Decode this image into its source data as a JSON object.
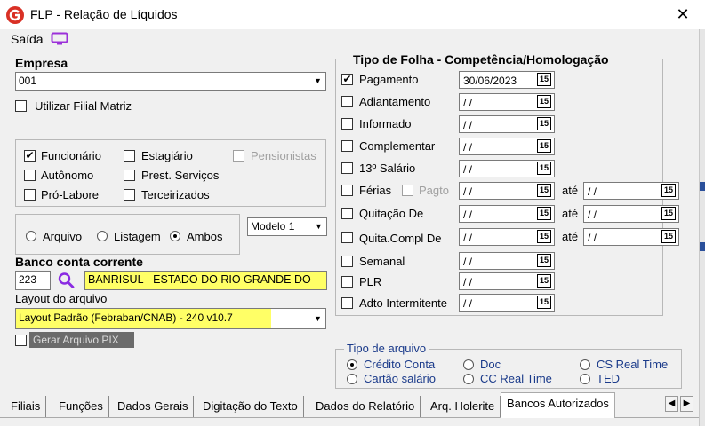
{
  "window": {
    "title": "FLP - Relação de Líquidos",
    "close_label": "✕"
  },
  "menu": {
    "saida_label": "Saída",
    "icon": "monitor-icon"
  },
  "empresa": {
    "label": "Empresa",
    "value": "001",
    "utilizar_filial_matriz": {
      "label": "Utilizar Filial Matriz",
      "checked": false
    }
  },
  "tipo_pessoa": [
    {
      "label": "Funcionário",
      "checked": true,
      "disabled": false
    },
    {
      "label": "Estagiário",
      "checked": false,
      "disabled": false
    },
    {
      "label": "Pensionistas",
      "checked": false,
      "disabled": true
    },
    {
      "label": "Autônomo",
      "checked": false,
      "disabled": false
    },
    {
      "label": "Prest. Serviços",
      "checked": false,
      "disabled": false
    },
    {
      "label": "Pró-Labore",
      "checked": false,
      "disabled": false
    },
    {
      "label": "Terceirizados",
      "checked": false,
      "disabled": false
    }
  ],
  "saida_tipo": {
    "options": [
      "Arquivo",
      "Listagem",
      "Ambos"
    ],
    "selected": "Ambos",
    "modelo": "Modelo 1"
  },
  "banco": {
    "label": "Banco conta corrente",
    "code": "223",
    "name": "BANRISUL - ESTADO DO RIO GRANDE DO"
  },
  "layout": {
    "label": "Layout do arquivo",
    "value": "Layout Padrão (Febraban/CNAB) - 240 v10.7"
  },
  "gerar_pix": {
    "label": "Gerar Arquivo PIX",
    "checked": false
  },
  "tipo_folha": {
    "header": "Tipo de Folha  -  Competência/Homologação",
    "ate_label": "até",
    "pagto_label": "Pagto",
    "cal_icon_text": "15",
    "rows": [
      {
        "label": "Pagamento",
        "checked": true,
        "date": "30/06/2023",
        "ate": null
      },
      {
        "label": "Adiantamento",
        "checked": false,
        "date": " /  /",
        "ate": null
      },
      {
        "label": "Informado",
        "checked": false,
        "date": " /  /",
        "ate": null
      },
      {
        "label": "Complementar",
        "checked": false,
        "date": " / /",
        "ate": null
      },
      {
        "label": "13º Salário",
        "checked": false,
        "date": " /  /",
        "ate": null
      },
      {
        "label": "Férias",
        "checked": false,
        "date": " /  /",
        "ate": " /  /"
      },
      {
        "label": "Quitação De",
        "checked": false,
        "date": " /  /",
        "ate": " /  /"
      },
      {
        "label": "Quita.Compl De",
        "checked": false,
        "date": " /  /",
        "ate": " /  /"
      },
      {
        "label": "Semanal",
        "checked": false,
        "date": " /  /",
        "ate": null
      },
      {
        "label": "PLR",
        "checked": false,
        "date": " /  /",
        "ate": null
      },
      {
        "label": "Adto Intermitente",
        "checked": false,
        "date": " /  /",
        "ate": null
      }
    ]
  },
  "tipo_arquivo": {
    "label": "Tipo de arquivo",
    "options": [
      "Crédito Conta",
      "Doc",
      "CS Real Time",
      "Cartão salário",
      "CC Real Time",
      "TED"
    ],
    "selected": "Crédito Conta"
  },
  "tabs": [
    "Filiais",
    "Funções",
    "Dados Gerais",
    "Digitação do Texto",
    "Dados do Relatório",
    "Arq. Holerite",
    "Bancos Autorizados"
  ],
  "active_tab": "Bancos Autorizados",
  "nav": {
    "prev": "◀",
    "next": "▶"
  }
}
